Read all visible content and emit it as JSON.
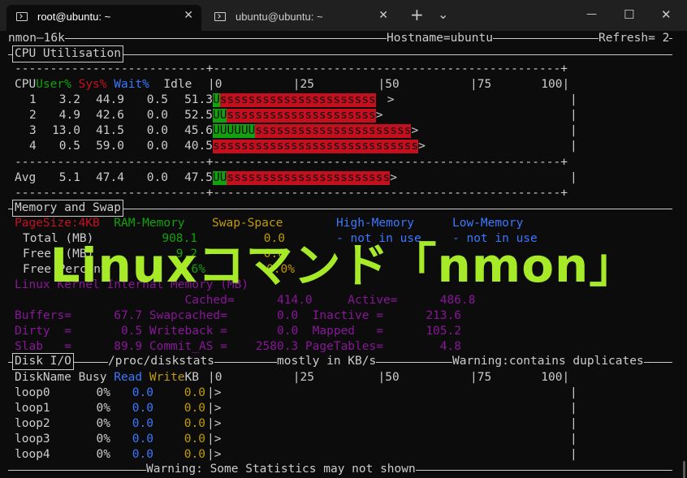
{
  "tabs": [
    {
      "title": "root@ubuntu: ~",
      "close": "✕",
      "icon": "terminal-icon"
    },
    {
      "title": "ubuntu@ubuntu: ~",
      "close": "✕",
      "icon": "terminal-icon"
    }
  ],
  "titlebar": {
    "new_tab": "+",
    "dropdown": "⌄",
    "minimize": "—",
    "maximize": "☐",
    "close": "✕"
  },
  "header": {
    "left": "nmon—16k",
    "hostname": "Hostname=ubuntu",
    "refresh": "Refresh= 2"
  },
  "cpu": {
    "title": "CPU Utilisation",
    "dashes": "---------------------------+-------------------------------------------------+",
    "scale": "|0          |25         |50          |75       100|",
    "head": {
      "cpu": "CPU",
      "user": "User%",
      "sys": "Sys%",
      "wait": "Wait%",
      "idle": "Idle"
    },
    "rows": [
      {
        "id": "1",
        "user": "3.2",
        "sys": "44.9",
        "wait": "0.5",
        "idle": "51.3",
        "ubar": "U",
        "sbar": "ssssssssssssssssssssss",
        "end": ">"
      },
      {
        "id": "2",
        "user": "4.9",
        "sys": "42.6",
        "wait": "0.0",
        "idle": "52.5",
        "ubar": "UU",
        "sbar": "sssssssssssssssssssss",
        "end": ">"
      },
      {
        "id": "3",
        "user": "13.0",
        "sys": "41.5",
        "wait": "0.0",
        "idle": "45.6",
        "ubar": "UUUUUU",
        "sbar": "ssssssssssssssssssssss",
        "end": ">"
      },
      {
        "id": "4",
        "user": "0.5",
        "sys": "59.0",
        "wait": "0.0",
        "idle": "40.5",
        "ubar": "",
        "sbar": "sssssssssssssssssssssssssssss",
        "end": ">"
      }
    ],
    "avg": {
      "label": "Avg",
      "user": "5.1",
      "sys": "47.4",
      "wait": "0.0",
      "idle": "47.5",
      "ubar": "UU",
      "sbar": "sssssssssssssssssssssss",
      "end": ">"
    }
  },
  "memory": {
    "title": "Memory and Swap",
    "head": {
      "pagesize": "PageSize:4KB",
      "ram": "RAM-Memory",
      "swap": "Swap-Space",
      "high": "High-Memory",
      "low": "Low-Memory"
    },
    "rows": [
      {
        "label": "Total (MB)",
        "ram": "908.1",
        "swap": "0.0",
        "high": "- not in use",
        "low": "- not in use"
      },
      {
        "label": "Free  (MB)",
        "ram": "9.2",
        "swap": "0.0"
      },
      {
        "label": "Free Percent",
        "ram": "7.6%",
        "swap": "0.0%"
      }
    ],
    "kernel_title": "Linux Kernel Internal Memory (MB)",
    "kernel_rows": [
      "                        Cached=      414.0     Active=      486.8",
      "Buffers=      67.7 Swapcached=       0.0  Inactive =      213.6",
      "Dirty  =       0.5 Writeback =       0.0  Mapped   =      105.2",
      "Slab   =      89.9 Commit_AS =    2580.3 PageTables=        4.8"
    ]
  },
  "disk": {
    "title": "Disk I/O",
    "path": "/proc/diskstats",
    "units": "mostly in KB/s",
    "warning": "Warning:contains duplicates",
    "head": {
      "name": "DiskName Busy ",
      "read": "Read ",
      "write": "Write",
      "kb": "KB"
    },
    "scale": "|0          |25         |50          |75       100|",
    "rows": [
      {
        "name": "loop0",
        "busy": "0%",
        "read": "0.0",
        "write": "0.0",
        "end": ">"
      },
      {
        "name": "loop1",
        "busy": "0%",
        "read": "0.0",
        "write": "0.0",
        "end": ">"
      },
      {
        "name": "loop2",
        "busy": "0%",
        "read": "0.0",
        "write": "0.0",
        "end": ">"
      },
      {
        "name": "loop3",
        "busy": "0%",
        "read": "0.0",
        "write": "0.0",
        "end": ">"
      },
      {
        "name": "loop4",
        "busy": "0%",
        "read": "0.0",
        "write": "0.0",
        "end": ">"
      }
    ],
    "footer": "Warning: Some Statistics may not shown"
  },
  "overlay_title": "Linuxコマンド「nmon」",
  "colors": {
    "user": "#13a10e",
    "sys": "#c50f1f",
    "wait": "#3b78ff",
    "swap": "#c19c00",
    "kernel": "#881798",
    "overlay": "#a6ea28"
  }
}
